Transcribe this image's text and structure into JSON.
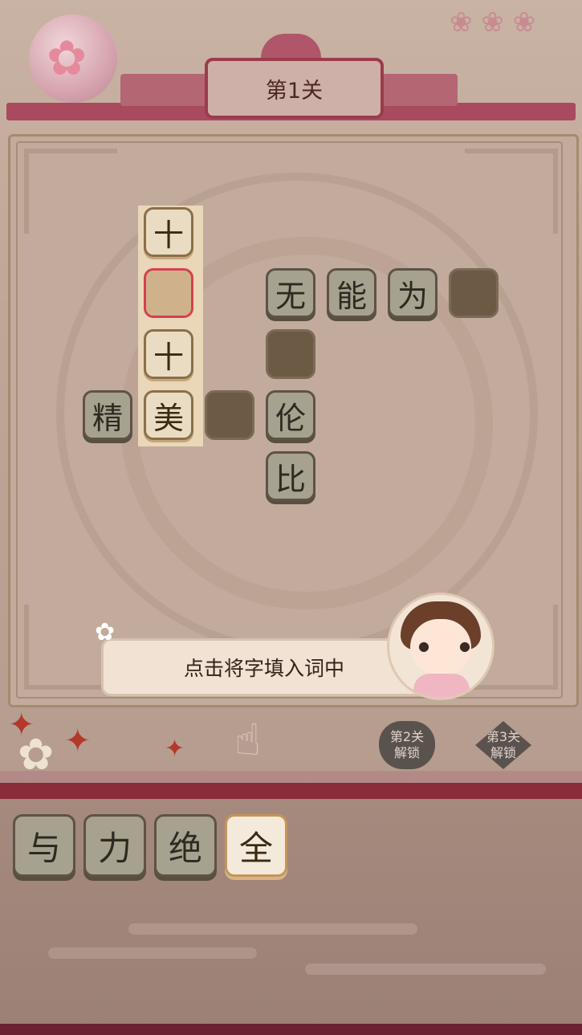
{
  "level": {
    "title": "第1关"
  },
  "grid": {
    "tiles": [
      {
        "id": "t-shi-top",
        "char": "十",
        "state": "light"
      },
      {
        "id": "t-sel",
        "char": "",
        "state": "selected"
      },
      {
        "id": "t-wu",
        "char": "无",
        "state": "filled"
      },
      {
        "id": "t-neng",
        "char": "能",
        "state": "filled"
      },
      {
        "id": "t-wei",
        "char": "为",
        "state": "filled"
      },
      {
        "id": "t-e1",
        "char": "",
        "state": "empty"
      },
      {
        "id": "t-shi-mid",
        "char": "十",
        "state": "light"
      },
      {
        "id": "t-e2",
        "char": "",
        "state": "empty"
      },
      {
        "id": "t-jing",
        "char": "精",
        "state": "filled"
      },
      {
        "id": "t-mei",
        "char": "美",
        "state": "light"
      },
      {
        "id": "t-e3",
        "char": "",
        "state": "empty"
      },
      {
        "id": "t-lun",
        "char": "伦",
        "state": "filled"
      },
      {
        "id": "t-bi",
        "char": "比",
        "state": "filled"
      }
    ]
  },
  "tip": {
    "text": "点击将字填入词中"
  },
  "unlocks": [
    {
      "line1": "第2关",
      "line2": "解锁"
    },
    {
      "line1": "第3关",
      "line2": "解锁"
    }
  ],
  "choices": [
    {
      "char": "与",
      "state": "dark"
    },
    {
      "char": "力",
      "state": "dark"
    },
    {
      "char": "绝",
      "state": "dark"
    },
    {
      "char": "全",
      "state": "light"
    }
  ],
  "colors": {
    "tile_border": "#5d5346",
    "selected_border": "#d3424e",
    "roof": "#a94a5e"
  }
}
